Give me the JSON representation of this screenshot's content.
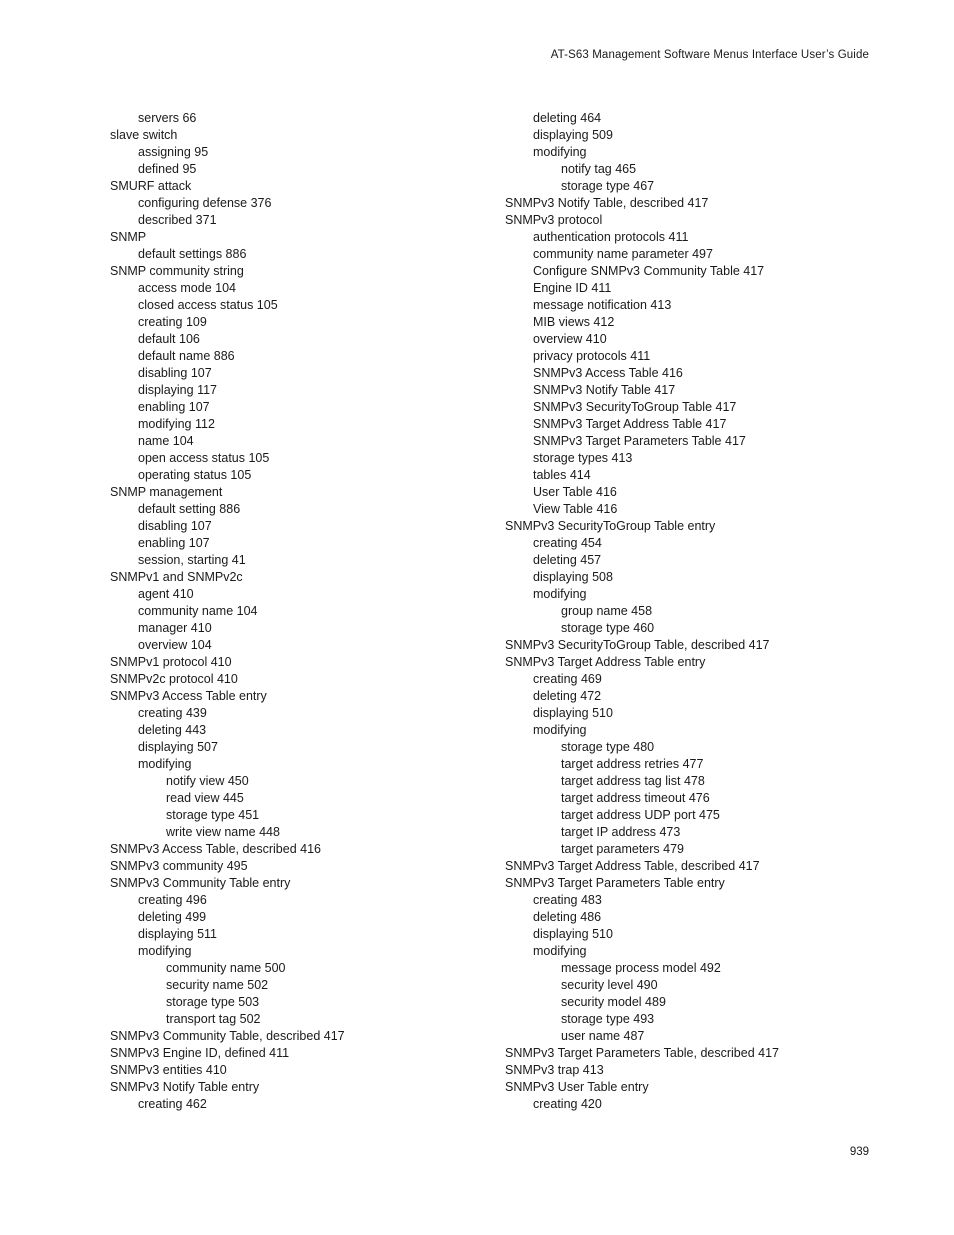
{
  "header": {
    "running_title": "AT-S63 Management Software Menus Interface User’s Guide"
  },
  "footer": {
    "page_number": "939"
  },
  "index": {
    "left_column": [
      {
        "level": 1,
        "text": "servers 66"
      },
      {
        "level": 0,
        "text": "slave switch"
      },
      {
        "level": 1,
        "text": "assigning 95"
      },
      {
        "level": 1,
        "text": "defined 95"
      },
      {
        "level": 0,
        "text": "SMURF attack"
      },
      {
        "level": 1,
        "text": "configuring defense 376"
      },
      {
        "level": 1,
        "text": "described 371"
      },
      {
        "level": 0,
        "text": "SNMP"
      },
      {
        "level": 1,
        "text": "default settings 886"
      },
      {
        "level": 0,
        "text": "SNMP community string"
      },
      {
        "level": 1,
        "text": "access mode 104"
      },
      {
        "level": 1,
        "text": "closed access status 105"
      },
      {
        "level": 1,
        "text": "creating 109"
      },
      {
        "level": 1,
        "text": "default 106"
      },
      {
        "level": 1,
        "text": "default name 886"
      },
      {
        "level": 1,
        "text": "disabling 107"
      },
      {
        "level": 1,
        "text": "displaying 117"
      },
      {
        "level": 1,
        "text": "enabling 107"
      },
      {
        "level": 1,
        "text": "modifying 112"
      },
      {
        "level": 1,
        "text": "name 104"
      },
      {
        "level": 1,
        "text": "open access status 105"
      },
      {
        "level": 1,
        "text": "operating status 105"
      },
      {
        "level": 0,
        "text": "SNMP management"
      },
      {
        "level": 1,
        "text": "default setting 886"
      },
      {
        "level": 1,
        "text": "disabling 107"
      },
      {
        "level": 1,
        "text": "enabling 107"
      },
      {
        "level": 1,
        "text": "session, starting 41"
      },
      {
        "level": 0,
        "text": "SNMPv1 and SNMPv2c"
      },
      {
        "level": 1,
        "text": "agent 410"
      },
      {
        "level": 1,
        "text": "community name 104"
      },
      {
        "level": 1,
        "text": "manager 410"
      },
      {
        "level": 1,
        "text": "overview 104"
      },
      {
        "level": 0,
        "text": "SNMPv1 protocol 410"
      },
      {
        "level": 0,
        "text": "SNMPv2c protocol 410"
      },
      {
        "level": 0,
        "text": "SNMPv3 Access Table entry"
      },
      {
        "level": 1,
        "text": "creating 439"
      },
      {
        "level": 1,
        "text": "deleting 443"
      },
      {
        "level": 1,
        "text": "displaying 507"
      },
      {
        "level": 1,
        "text": "modifying"
      },
      {
        "level": 2,
        "text": "notify view 450"
      },
      {
        "level": 2,
        "text": "read view 445"
      },
      {
        "level": 2,
        "text": "storage type 451"
      },
      {
        "level": 2,
        "text": "write view name 448"
      },
      {
        "level": 0,
        "text": "SNMPv3 Access Table, described 416"
      },
      {
        "level": 0,
        "text": "SNMPv3 community 495"
      },
      {
        "level": 0,
        "text": "SNMPv3 Community Table entry"
      },
      {
        "level": 1,
        "text": "creating 496"
      },
      {
        "level": 1,
        "text": "deleting 499"
      },
      {
        "level": 1,
        "text": "displaying 511"
      },
      {
        "level": 1,
        "text": "modifying"
      },
      {
        "level": 2,
        "text": "community name 500"
      },
      {
        "level": 2,
        "text": "security name 502"
      },
      {
        "level": 2,
        "text": "storage type 503"
      },
      {
        "level": 2,
        "text": "transport tag 502"
      },
      {
        "level": 0,
        "text": "SNMPv3 Community Table, described 417"
      },
      {
        "level": 0,
        "text": "SNMPv3 Engine ID, defined 411"
      },
      {
        "level": 0,
        "text": "SNMPv3 entities 410"
      },
      {
        "level": 0,
        "text": "SNMPv3 Notify Table entry"
      },
      {
        "level": 1,
        "text": "creating 462"
      }
    ],
    "right_column": [
      {
        "level": 1,
        "text": "deleting 464"
      },
      {
        "level": 1,
        "text": "displaying 509"
      },
      {
        "level": 1,
        "text": "modifying"
      },
      {
        "level": 2,
        "text": "notify tag 465"
      },
      {
        "level": 2,
        "text": "storage type 467"
      },
      {
        "level": 0,
        "text": "SNMPv3 Notify Table, described 417"
      },
      {
        "level": 0,
        "text": "SNMPv3 protocol"
      },
      {
        "level": 1,
        "text": "authentication protocols 411"
      },
      {
        "level": 1,
        "text": "community name parameter 497"
      },
      {
        "level": 1,
        "text": "Configure SNMPv3 Community Table 417"
      },
      {
        "level": 1,
        "text": "Engine ID 411"
      },
      {
        "level": 1,
        "text": "message notification 413"
      },
      {
        "level": 1,
        "text": "MIB views 412"
      },
      {
        "level": 1,
        "text": "overview 410"
      },
      {
        "level": 1,
        "text": "privacy protocols 411"
      },
      {
        "level": 1,
        "text": "SNMPv3 Access Table 416"
      },
      {
        "level": 1,
        "text": "SNMPv3 Notify Table 417"
      },
      {
        "level": 1,
        "text": "SNMPv3 SecurityToGroup Table 417"
      },
      {
        "level": 1,
        "text": "SNMPv3 Target Address Table 417"
      },
      {
        "level": 1,
        "text": "SNMPv3 Target Parameters Table 417"
      },
      {
        "level": 1,
        "text": "storage types 413"
      },
      {
        "level": 1,
        "text": "tables 414"
      },
      {
        "level": 1,
        "text": "User Table 416"
      },
      {
        "level": 1,
        "text": "View Table 416"
      },
      {
        "level": 0,
        "text": "SNMPv3 SecurityToGroup Table entry"
      },
      {
        "level": 1,
        "text": "creating 454"
      },
      {
        "level": 1,
        "text": "deleting 457"
      },
      {
        "level": 1,
        "text": "displaying 508"
      },
      {
        "level": 1,
        "text": "modifying"
      },
      {
        "level": 2,
        "text": "group name 458"
      },
      {
        "level": 2,
        "text": "storage type 460"
      },
      {
        "level": 0,
        "text": "SNMPv3 SecurityToGroup Table, described 417"
      },
      {
        "level": 0,
        "text": "SNMPv3 Target Address Table entry"
      },
      {
        "level": 1,
        "text": "creating 469"
      },
      {
        "level": 1,
        "text": "deleting 472"
      },
      {
        "level": 1,
        "text": "displaying 510"
      },
      {
        "level": 1,
        "text": "modifying"
      },
      {
        "level": 2,
        "text": "storage type 480"
      },
      {
        "level": 2,
        "text": "target address retries 477"
      },
      {
        "level": 2,
        "text": "target address tag list 478"
      },
      {
        "level": 2,
        "text": "target address timeout 476"
      },
      {
        "level": 2,
        "text": "target address UDP port 475"
      },
      {
        "level": 2,
        "text": "target IP address 473"
      },
      {
        "level": 2,
        "text": "target parameters 479"
      },
      {
        "level": 0,
        "text": "SNMPv3 Target Address Table, described 417"
      },
      {
        "level": 0,
        "text": "SNMPv3 Target Parameters Table entry"
      },
      {
        "level": 1,
        "text": "creating 483"
      },
      {
        "level": 1,
        "text": "deleting 486"
      },
      {
        "level": 1,
        "text": "displaying 510"
      },
      {
        "level": 1,
        "text": "modifying"
      },
      {
        "level": 2,
        "text": "message process model 492"
      },
      {
        "level": 2,
        "text": "security level 490"
      },
      {
        "level": 2,
        "text": "security model 489"
      },
      {
        "level": 2,
        "text": "storage type 493"
      },
      {
        "level": 2,
        "text": "user name 487"
      },
      {
        "level": 0,
        "text": "SNMPv3 Target Parameters Table, described 417"
      },
      {
        "level": 0,
        "text": "SNMPv3 trap 413"
      },
      {
        "level": 0,
        "text": "SNMPv3 User Table entry"
      },
      {
        "level": 1,
        "text": "creating 420"
      }
    ]
  }
}
